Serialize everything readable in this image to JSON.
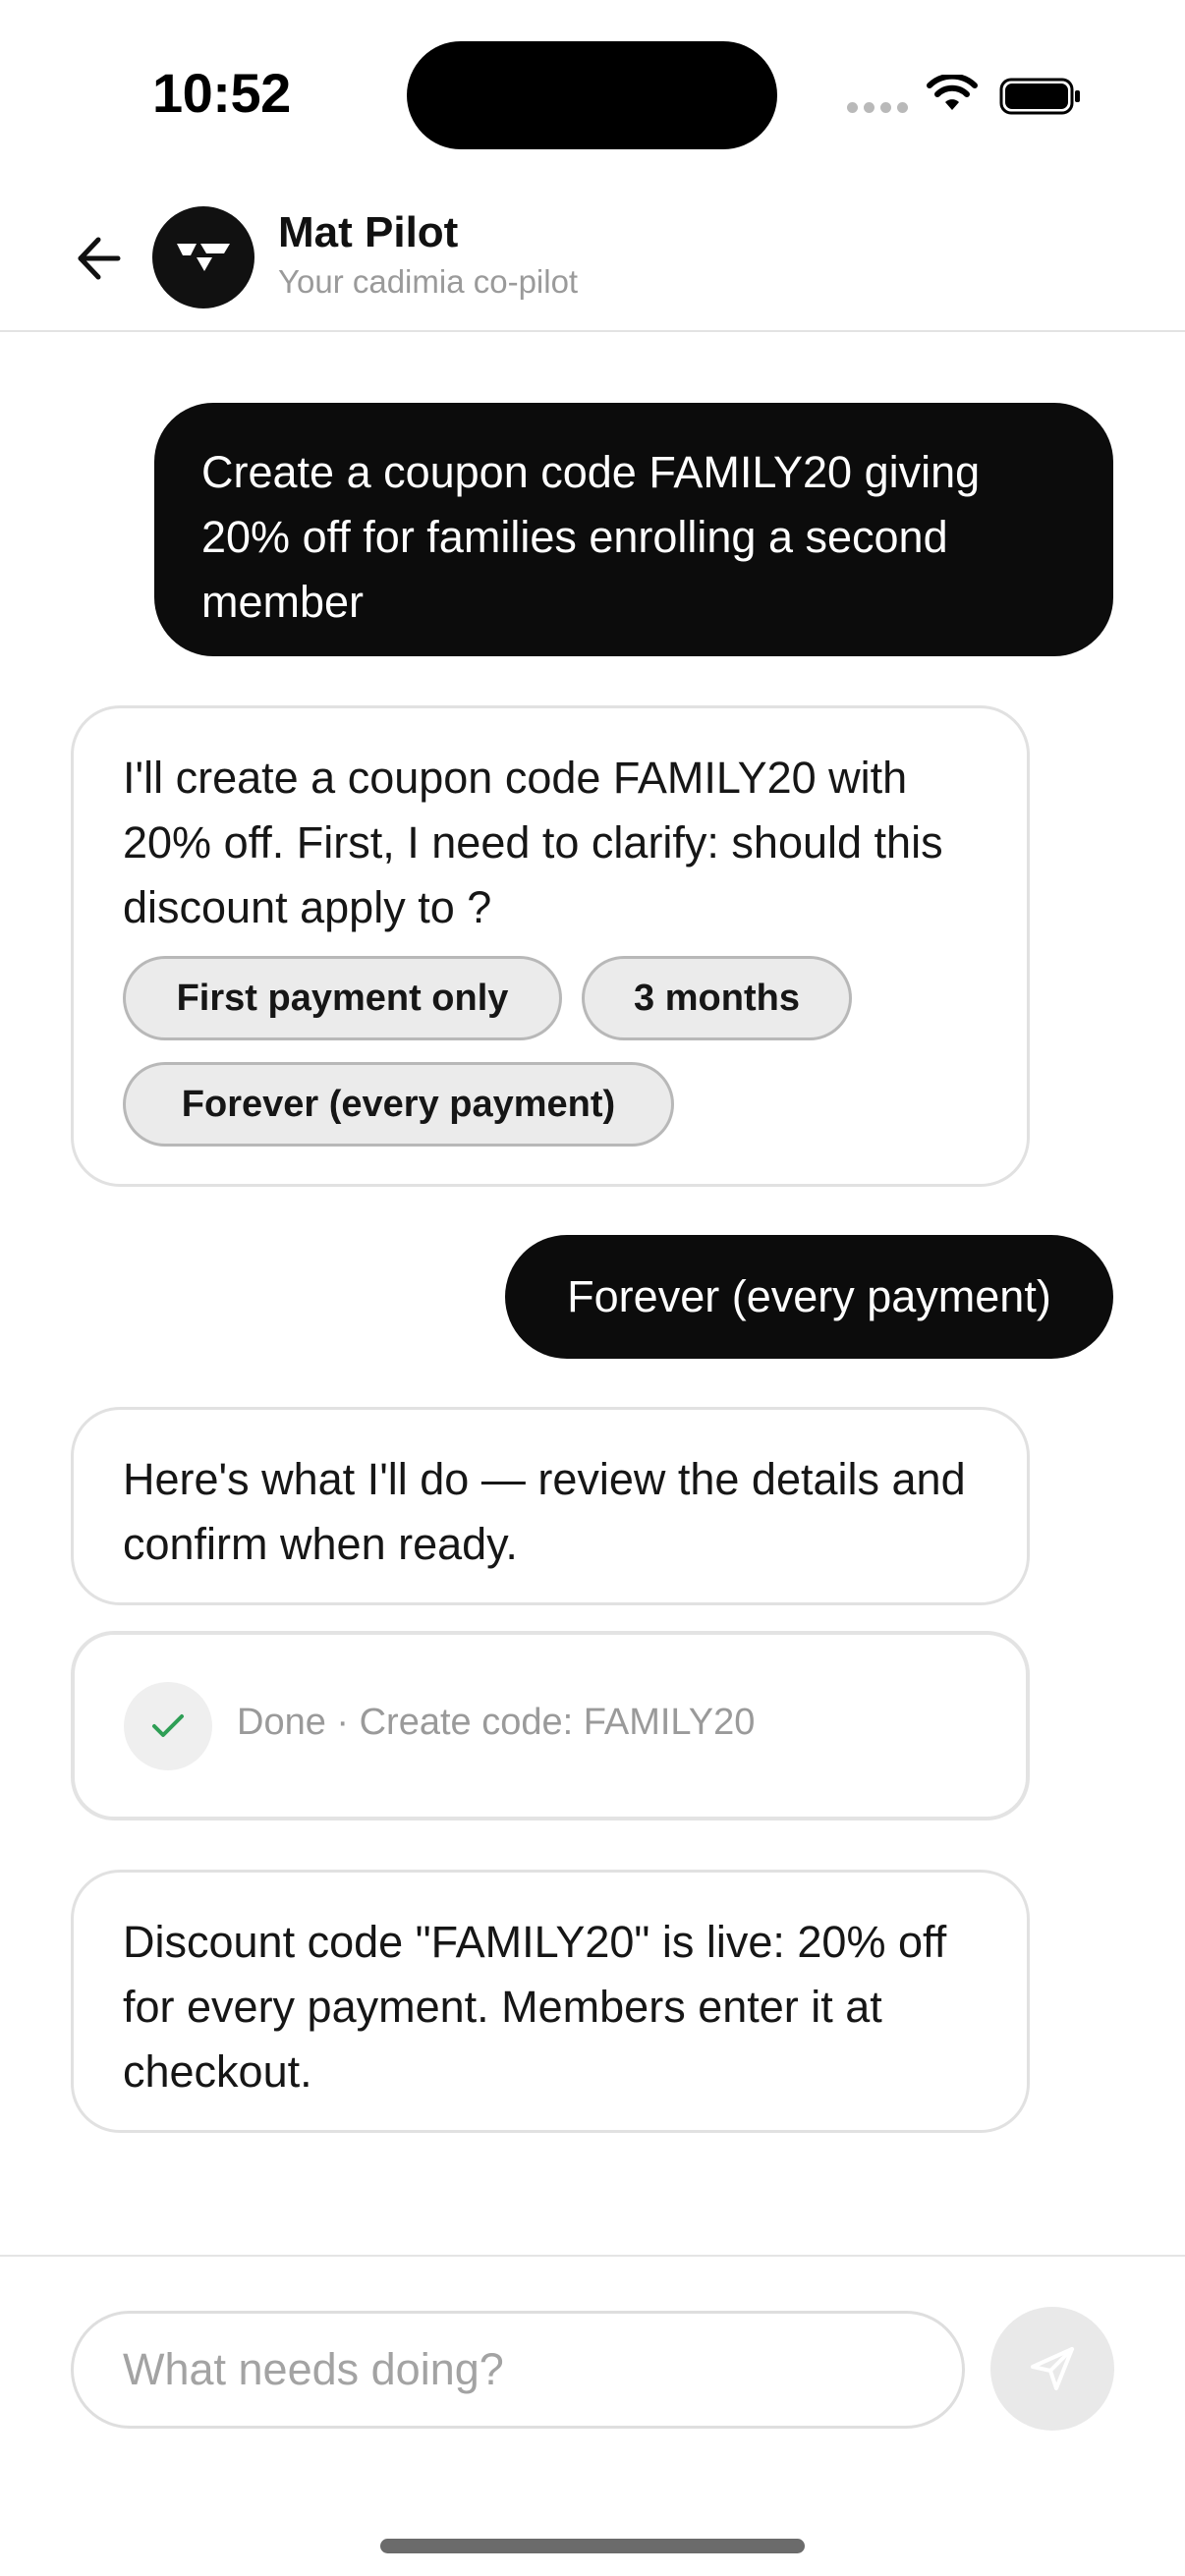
{
  "status_bar": {
    "time": "10:52"
  },
  "header": {
    "title": "Mat Pilot",
    "subtitle": "Your cadimia co-pilot",
    "back_icon": "arrow-left-icon",
    "avatar_icon": "cadimia-logo-icon"
  },
  "messages": [
    {
      "role": "user",
      "text": "Create a coupon code FAMILY20 giving 20% off for families enrolling a second member"
    },
    {
      "role": "assistant",
      "text": "I'll create a coupon code FAMILY20 with 20% off. First, I need to clarify: should this discount apply to   ?",
      "options": [
        "First payment only",
        "3 months",
        "Forever (every payment)"
      ]
    },
    {
      "role": "user",
      "text": "Forever (every payment)"
    },
    {
      "role": "assistant",
      "text": "Here's what I'll do — review the details and confirm when ready."
    },
    {
      "role": "task",
      "status_icon": "checkmark-icon",
      "text": "Done · Create code: FAMILY20"
    },
    {
      "role": "assistant",
      "text": "Discount code \"FAMILY20\" is live: 20% off for every payment. Members enter it at checkout."
    }
  ],
  "composer": {
    "placeholder": "What needs doing?",
    "send_icon": "send-icon"
  },
  "colors": {
    "user_bubble": "#0c0c0c",
    "bot_border": "#e1e1e1",
    "chip_background": "#ebebeb",
    "check_green": "#2e9e55",
    "muted_text": "#9a9a9a"
  }
}
